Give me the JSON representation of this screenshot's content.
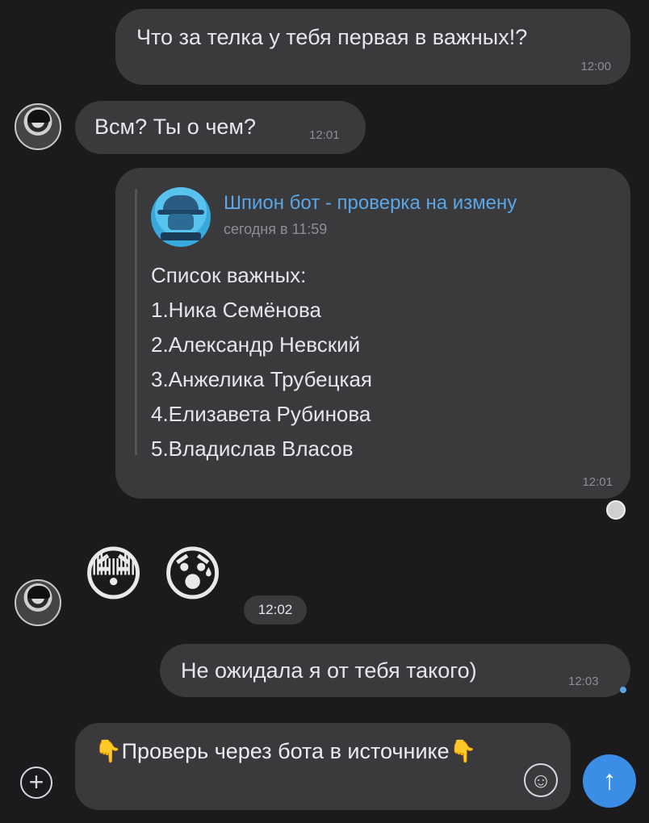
{
  "messages": {
    "m1": {
      "text": "Что за телка у тебя первая в важных!?",
      "time": "12:00"
    },
    "m2": {
      "text": "Всм? Ты о чем?",
      "time": "12:01"
    },
    "forwarded": {
      "bot_name": "Шпион бот - проверка на измену",
      "date": "сегодня в 11:59",
      "list_title": "Список важных:",
      "items": [
        "1.Ника Семёнова",
        "2.Александр Невский",
        "3.Анжелика Трубецкая",
        "4.Елизавета Рубинова",
        "5.Владислав Власов"
      ],
      "time": "12:01"
    },
    "emoji_msg": {
      "emoji1": "😳",
      "emoji2": "😰",
      "time": "12:02"
    },
    "m3": {
      "text": "Не ожидала я от тебя такого)",
      "time": "12:03"
    }
  },
  "composer": {
    "text": "👇Проверь через бота в источнике👇",
    "plus_icon": "plus-icon",
    "emoji_icon": "smile-icon",
    "send_icon": "arrow-up-icon"
  },
  "colors": {
    "background": "#1b1b1d",
    "bubble": "#3a3a3c",
    "accent": "#3a8ee6",
    "link": "#5aa6e6"
  }
}
